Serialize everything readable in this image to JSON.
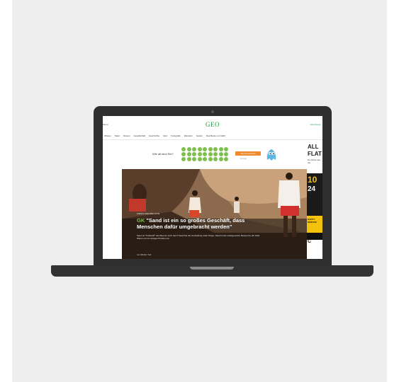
{
  "website": {
    "logo": "GEO",
    "top_right_link": "Abonnieren",
    "left_edge": "Menü",
    "nav": [
      "Wissen",
      "Natur",
      "Reisen",
      "Gesellschaft",
      "Geschichte",
      "Quiz",
      "Fotografie",
      "Wandern",
      "Garten",
      "Das Beste von GEO"
    ],
    "banner": {
      "label": "Wie alt sind Sie?",
      "button": "Jetzt berechnen",
      "subtext": "Anzeige"
    },
    "hero": {
      "kicker": "MENSCHENRECHTE",
      "tag": "GK",
      "headline": "\"Sand ist ein so großes Geschäft, dass Menschen dafür umgebracht werden\"",
      "teaser": "Sand ist \"Treibstoff\" des Booms: auch durch Sand bei der Herstellung vieler Dinge. Sand ist die meistgenutzte Ressource der Welt. Warum es ein riesiges Problem ist.",
      "byline": "von Marius Tod"
    },
    "ad": {
      "line1": "ALL",
      "line2": "FLAT",
      "line3": "So sicher wie nie",
      "big1": "10",
      "big2": "24",
      "yellow_text": "HAPPY SERVICE",
      "bottom": "C"
    }
  },
  "colors": {
    "brand_green": "#1f9e3f",
    "accent_orange": "#ef8a2c",
    "dot_green": "#7fbf4d",
    "laptop_body": "#2f2f2f",
    "ad_yellow": "#f4c20d"
  }
}
